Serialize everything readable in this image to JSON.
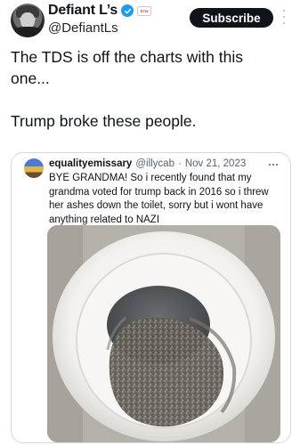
{
  "post": {
    "author": {
      "display_name": "Defiant L’s",
      "handle": "@DefiantLs",
      "verified": true,
      "affiliate_badge": "RTM"
    },
    "subscribe_label": "Subscribe",
    "text_lines": [
      "The TDS is off the charts with this",
      "one...",
      "Trump broke these people."
    ]
  },
  "quote": {
    "author": {
      "display_name": "equalityemissary",
      "handle": "@illycab",
      "separator": "·",
      "date": "Nov 21, 2023"
    },
    "text_lines": [
      "BYE GRANDMA! So i recently found that my",
      "grandma voted for trump back in 2016 so i threw",
      "her ashes down the toilet, sorry but i wont have",
      "anything related to NAZI"
    ],
    "image_description_icon": "toilet-with-ashes-photo"
  },
  "colors": {
    "verified": "#1d9bf0",
    "subscribe_bg": "#0f1419",
    "text": "#0f1419",
    "muted": "#536471",
    "border": "#cfd9de"
  }
}
